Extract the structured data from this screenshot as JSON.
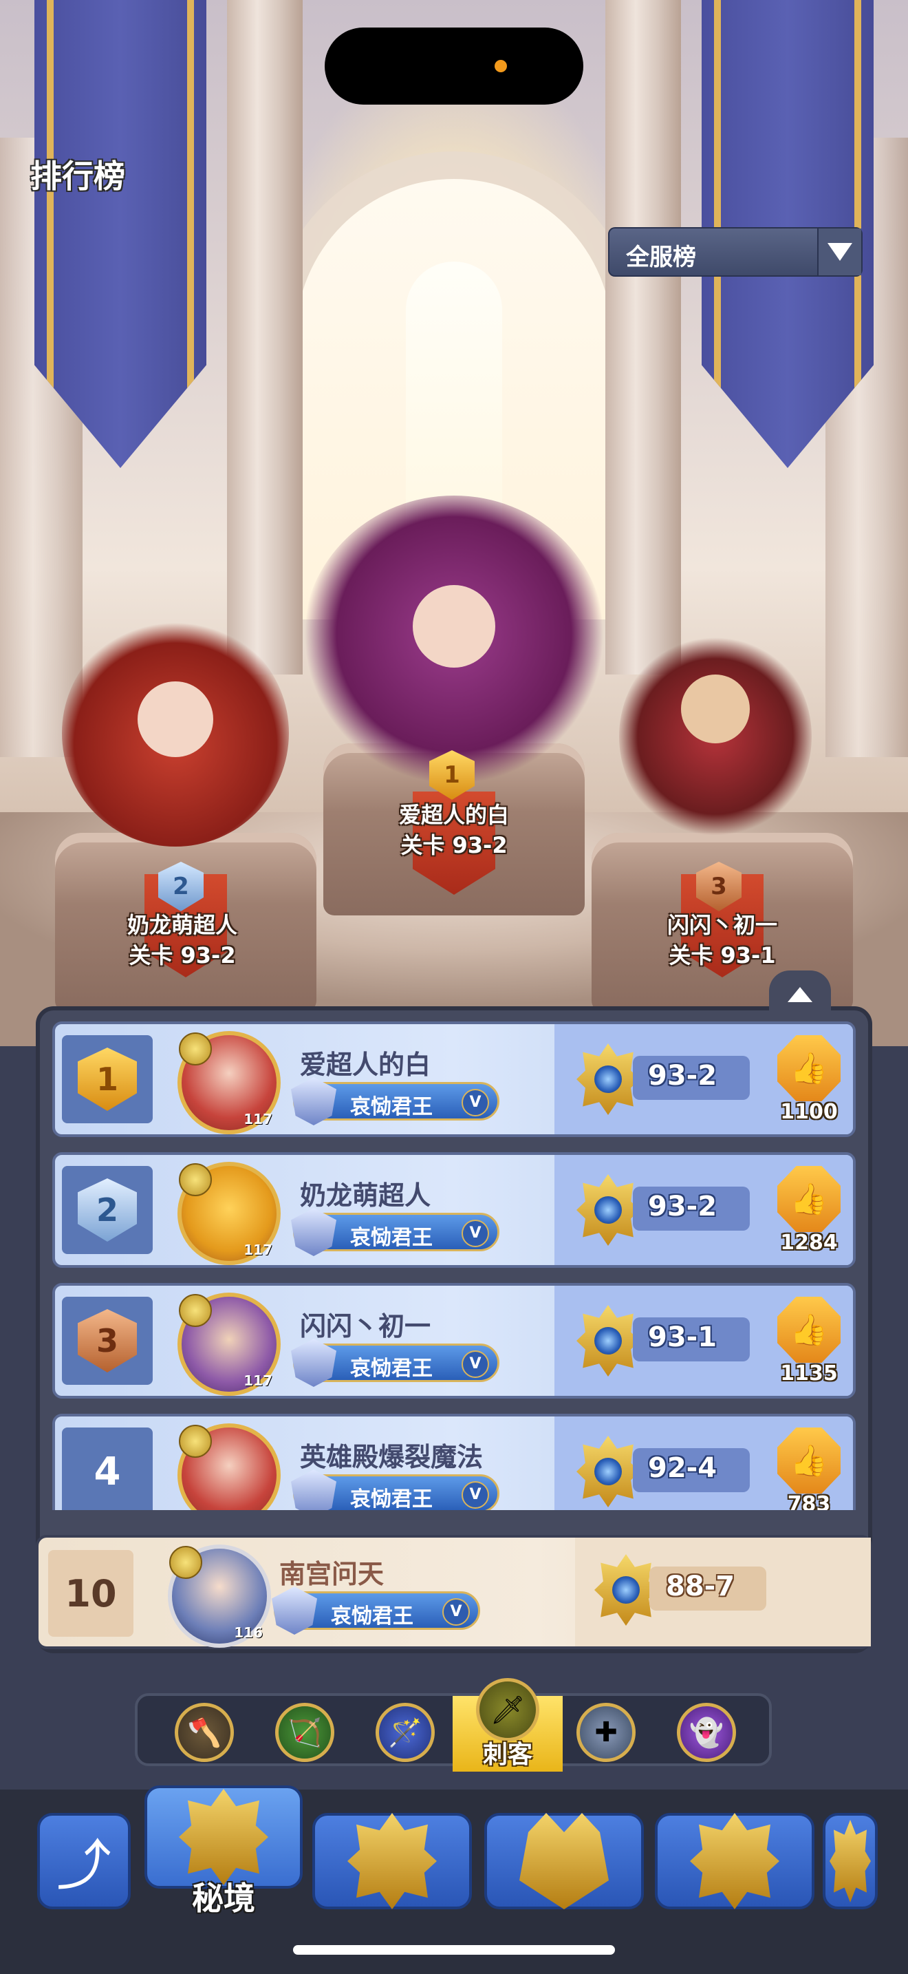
{
  "header": {
    "title": "排行榜",
    "scope_dropdown": "全服榜"
  },
  "podium": [
    {
      "rank": "1",
      "name": "爱超人的白",
      "stage": "关卡 93-2"
    },
    {
      "rank": "2",
      "name": "奶龙萌超人",
      "stage": "关卡 93-2"
    },
    {
      "rank": "3",
      "name": "闪闪丶初一",
      "stage": "关卡 93-1"
    }
  ],
  "rows": [
    {
      "rank": "1",
      "name": "爱超人的白",
      "level": "117",
      "title": "哀恸君王",
      "vip": "V",
      "stage": "93-2",
      "likes": "1100"
    },
    {
      "rank": "2",
      "name": "奶龙萌超人",
      "level": "117",
      "title": "哀恸君王",
      "vip": "V",
      "stage": "93-2",
      "likes": "1284"
    },
    {
      "rank": "3",
      "name": "闪闪丶初一",
      "level": "117",
      "title": "哀恸君王",
      "vip": "V",
      "stage": "93-1",
      "likes": "1135"
    },
    {
      "rank": "4",
      "name": "英雄殿爆裂魔法",
      "level": "",
      "title": "哀恸君王",
      "vip": "V",
      "stage": "92-4",
      "likes": "783"
    }
  ],
  "my_row": {
    "rank": "10",
    "name": "南宫问天",
    "level": "116",
    "title": "哀恸君王",
    "vip": "V",
    "stage": "88-7"
  },
  "class_tabs": {
    "active_label": "刺客",
    "icons": [
      "warrior-axe-icon",
      "archer-bow-icon",
      "mage-staff-icon",
      "assassin-blade-icon",
      "priest-cross-icon",
      "summoner-ghost-icon"
    ]
  },
  "bottom_nav": {
    "active_label": "秘境",
    "icons": [
      "back-arrow-icon",
      "secret-realm-icon",
      "purple-eye-emblem-icon",
      "crown-emblem-icon",
      "star-emblem-icon",
      "partial-emblem-icon"
    ]
  },
  "colors": {
    "accent_gold": "#e9b519",
    "panel": "#454a5f",
    "row_blue": "#c7d8f5"
  }
}
